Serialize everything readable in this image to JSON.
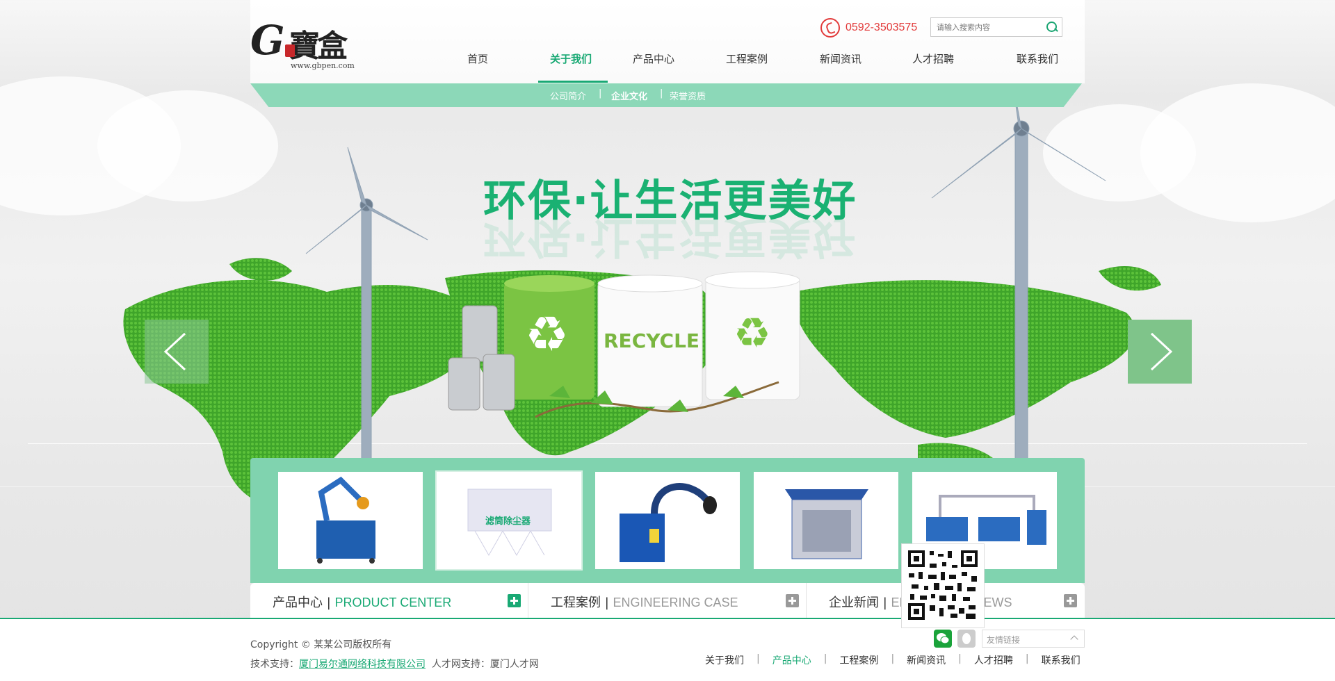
{
  "header": {
    "logo": {
      "glyph": "G",
      "text": "寶盒",
      "url": "www.gbpen.com"
    },
    "phone": "0592-3503575",
    "search": {
      "placeholder": "请输入搜索内容"
    }
  },
  "nav": {
    "items": [
      "首页",
      "关于我们",
      "产品中心",
      "工程案例",
      "新闻资讯",
      "人才招聘",
      "联系我们"
    ],
    "active": "关于我们"
  },
  "subnav": {
    "items": [
      "公司简介",
      "企业文化",
      "荣誉资质"
    ],
    "current": "企业文化"
  },
  "hero": {
    "slogan": "环保·让生活更美好",
    "recycle_text": "RECYCLE"
  },
  "products": {
    "cards": [
      {
        "name": "arm-dust-collector"
      },
      {
        "name": "filter-dust-collector",
        "label": "滤筒除尘器"
      },
      {
        "name": "mobile-fume-extractor"
      },
      {
        "name": "spray-booth"
      },
      {
        "name": "dual-workbench-system"
      }
    ]
  },
  "tabs": [
    {
      "cn": "产品中心",
      "en": "PRODUCT CENTER"
    },
    {
      "cn": "工程案例",
      "en": "ENGINEERING CASE"
    },
    {
      "cn": "企业新闻",
      "en": "ENTERPRISE NEWS"
    }
  ],
  "footer": {
    "copyright": "Copyright © 某某公司版权所有",
    "tech_prefix": "技术支持：",
    "tech_link": "厦门易尔通网络科技有限公司",
    "talent": "人才网支持：厦门人才网",
    "links": [
      "关于我们",
      "产品中心",
      "工程案例",
      "新闻资讯",
      "人才招聘",
      "联系我们"
    ],
    "friend_links": "友情链接"
  },
  "colors": {
    "accent": "#19a974",
    "strip": "#80d3af",
    "phone": "#e23b3b"
  }
}
